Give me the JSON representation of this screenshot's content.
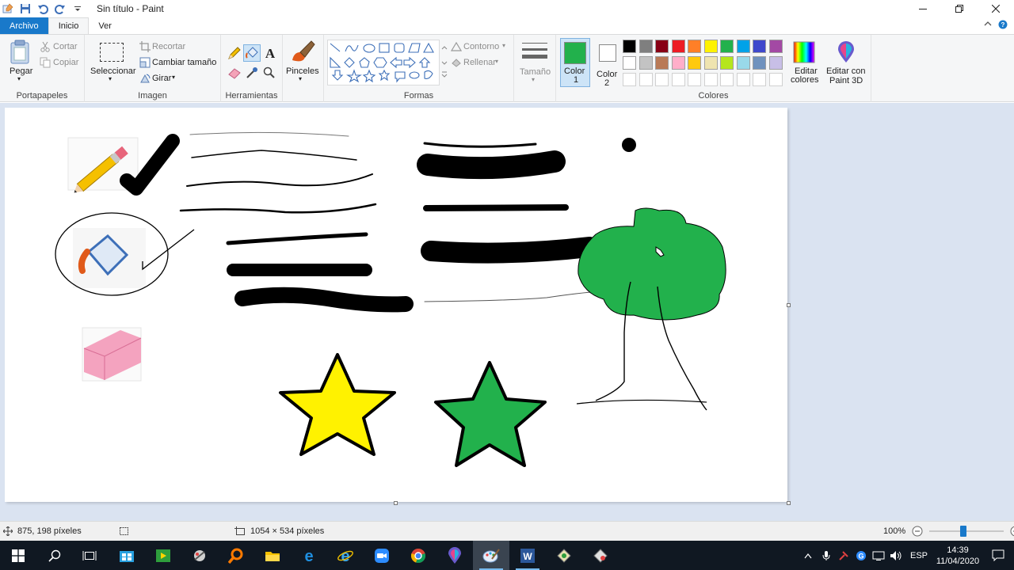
{
  "window": {
    "title": "Sin título - Paint"
  },
  "tabs": {
    "file": "Archivo",
    "home": "Inicio",
    "view": "Ver"
  },
  "ribbon": {
    "clipboard": {
      "paste": "Pegar",
      "cut": "Cortar",
      "copy": "Copiar",
      "group_label": "Portapapeles"
    },
    "image": {
      "select": "Seleccionar",
      "crop": "Recortar",
      "resize": "Cambiar tamaño",
      "rotate": "Girar",
      "group_label": "Imagen"
    },
    "tools": {
      "group_label": "Herramientas"
    },
    "brushes": {
      "label": "Pinceles"
    },
    "shapes": {
      "outline": "Contorno",
      "fill": "Rellenar",
      "group_label": "Formas"
    },
    "size": {
      "label": "Tamaño"
    },
    "colors": {
      "color1_label": "Color",
      "color1_num": "1",
      "color2_label": "Color",
      "color2_num": "2",
      "color1_value": "#22b14c",
      "color2_value": "#ffffff",
      "edit_colors_1": "Editar",
      "edit_colors_2": "colores",
      "paint3d_1": "Editar con",
      "paint3d_2": "Paint 3D",
      "group_label": "Colores",
      "palette_row1": [
        "#000000",
        "#7f7f7f",
        "#880015",
        "#ed1c24",
        "#ff7f27",
        "#fff200",
        "#22b14c",
        "#00a2e8",
        "#3f48cc",
        "#a349a4"
      ],
      "palette_row2": [
        "#ffffff",
        "#c3c3c3",
        "#b97a57",
        "#ffaec9",
        "#ffc90e",
        "#efe4b0",
        "#b5e61d",
        "#99d9ea",
        "#7092be",
        "#c8bfe7"
      ]
    }
  },
  "canvas": {
    "background": "#ffffff",
    "star_yellow": "#fff200",
    "star_green": "#22b14c",
    "tree_green": "#22b14c"
  },
  "status": {
    "cursor_pos": "875, 198 píxeles",
    "image_size": "1054 × 534 píxeles",
    "zoom": "100%"
  },
  "taskbar": {
    "language": "ESP",
    "time": "14:39",
    "date": "11/04/2020"
  }
}
